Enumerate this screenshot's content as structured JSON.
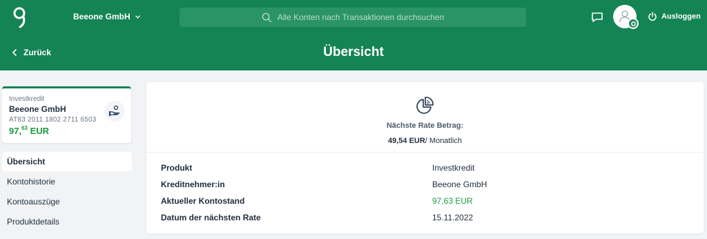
{
  "topbar": {
    "company_name": "Beeone GmbH",
    "search_placeholder": "Alle Konten nach Transaktionen durchsuchen",
    "logout_label": "Ausloggen"
  },
  "subheader": {
    "back_label": "Zurück",
    "title": "Übersicht"
  },
  "account_card": {
    "type": "Investkredit",
    "name": "Beeone GmbH",
    "iban": "AT83 2011 1802 2711 6503",
    "balance_main": "97,",
    "balance_decimal": "63",
    "balance_currency": " EUR"
  },
  "nav": {
    "items": [
      {
        "label": "Übersicht",
        "active": true
      },
      {
        "label": "Kontohistorie",
        "active": false
      },
      {
        "label": "Kontoauszüge",
        "active": false
      },
      {
        "label": "Produktdetails",
        "active": false
      }
    ]
  },
  "rate": {
    "label": "Nächste Rate Betrag:",
    "amount": "49,54 EUR",
    "period": "/ Monatlich"
  },
  "details": {
    "rows": [
      {
        "key": "Produkt",
        "value": "Investkredit"
      },
      {
        "key": "Kreditnehmer:in",
        "value": "Beeone GmbH"
      },
      {
        "key": "Aktueller Kontostand",
        "value": "97,63 EUR"
      },
      {
        "key": "Datum der nächsten Rate",
        "value": "15.11.2022"
      }
    ]
  },
  "colors": {
    "brand_green": "#148455",
    "balance_green": "#1a9a3c",
    "background": "#f1f3f5"
  },
  "icons": [
    "app-logo-icon",
    "chevron-down-icon",
    "search-icon",
    "chat-icon",
    "user-icon",
    "gear-icon",
    "power-icon",
    "chevron-left-icon",
    "loan-hand-icon",
    "pie-chart-icon"
  ]
}
